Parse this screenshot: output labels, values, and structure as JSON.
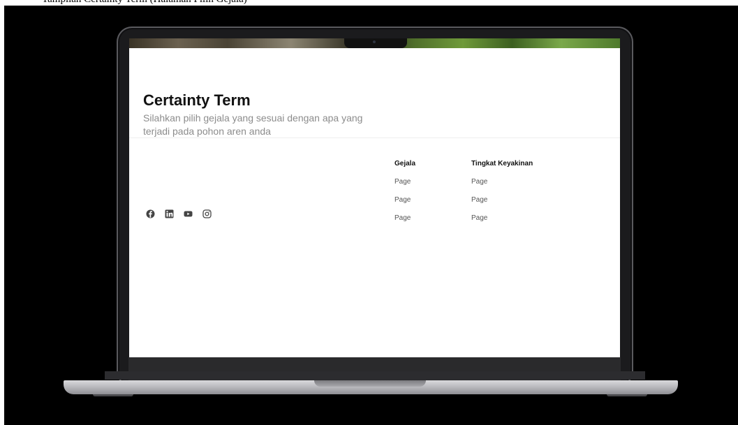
{
  "caption": "Tampilan Certainty Term (Halaman Pilih Gejala)",
  "page": {
    "title": "Certainty Term",
    "subtitle": "Silahkan pilih gejala yang sesuai dengan apa yang terjadi pada pohon aren anda"
  },
  "social_icons": [
    "facebook-icon",
    "linkedin-icon",
    "youtube-icon",
    "instagram-icon"
  ],
  "table": {
    "headers": [
      "Gejala",
      "Tingkat Keyakinan"
    ],
    "rows": [
      [
        "Page",
        "Page"
      ],
      [
        "Page",
        "Page"
      ],
      [
        "Page",
        "Page"
      ]
    ]
  },
  "colors": {
    "background": "#000000",
    "screen": "#ffffff",
    "title": "#111111",
    "subtitle": "#8c8c8c"
  }
}
